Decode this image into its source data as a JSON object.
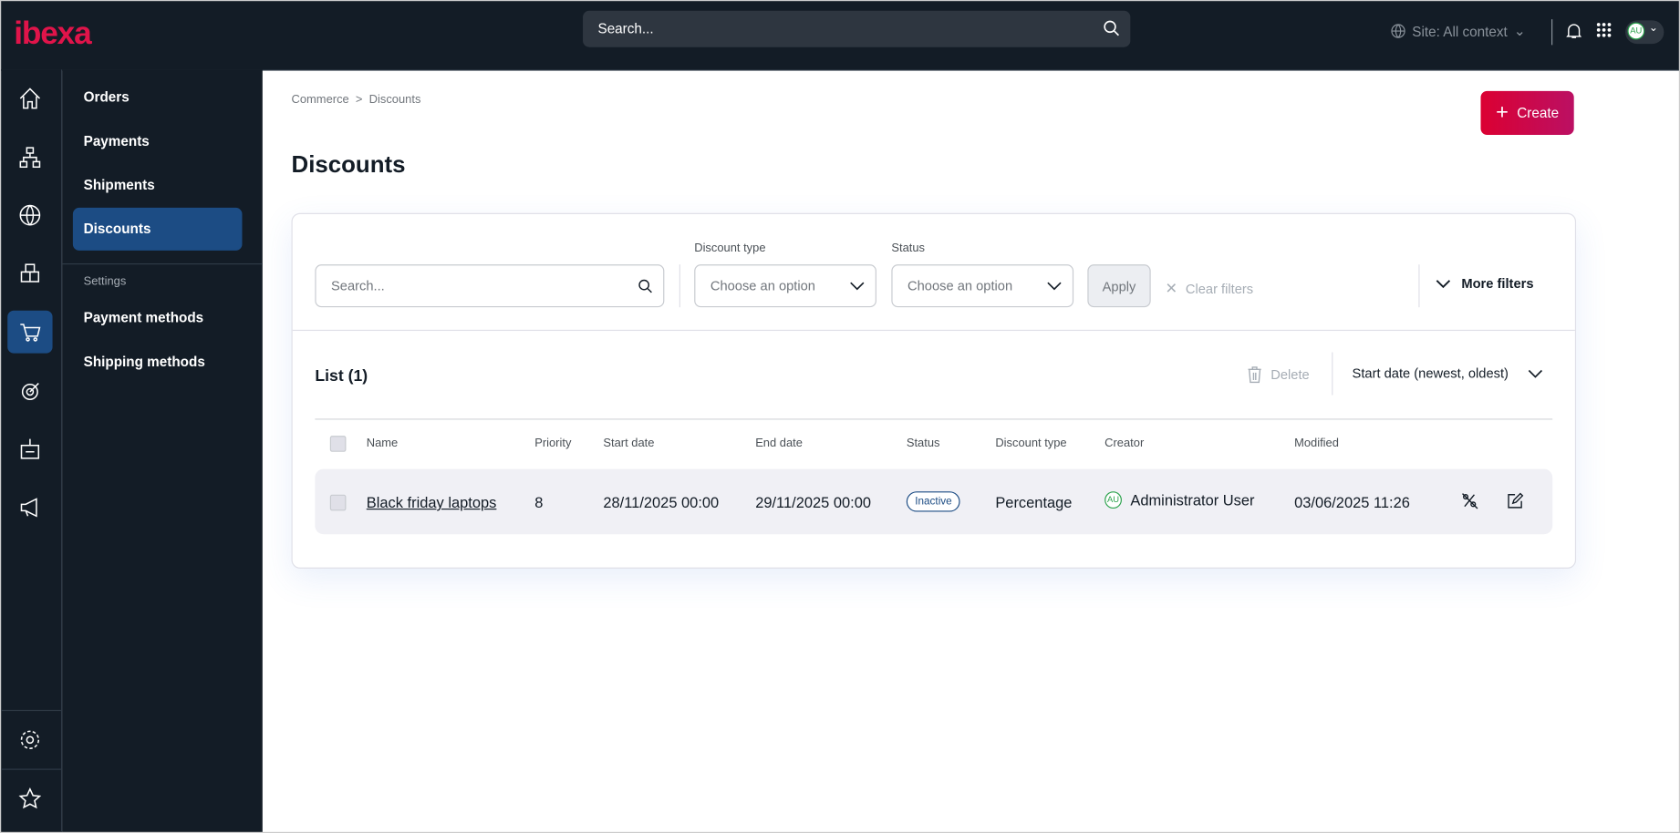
{
  "header": {
    "logo": "ibexa",
    "search_placeholder": "Search...",
    "site_label": "Site: All context",
    "avatar_initials": "AU"
  },
  "rail": [
    "home",
    "content-tree",
    "globe",
    "products",
    "commerce",
    "targeting",
    "customers",
    "marketing",
    "settings",
    "favorites"
  ],
  "sidebar": {
    "items": [
      {
        "label": "Orders"
      },
      {
        "label": "Payments"
      },
      {
        "label": "Shipments"
      },
      {
        "label": "Discounts",
        "active": true
      }
    ],
    "settings_heading": "Settings",
    "settings_items": [
      {
        "label": "Payment methods"
      },
      {
        "label": "Shipping methods"
      }
    ]
  },
  "breadcrumb": {
    "parent": "Commerce",
    "sep": ">",
    "current": "Discounts"
  },
  "page_title": "Discounts",
  "create_label": "Create",
  "filters": {
    "search_placeholder": "Search...",
    "discount_type_label": "Discount type",
    "discount_type_value": "Choose an option",
    "status_label": "Status",
    "status_value": "Choose an option",
    "apply": "Apply",
    "clear": "Clear filters",
    "more": "More filters"
  },
  "list": {
    "title": "List (1)",
    "delete": "Delete",
    "sort": "Start date (newest, oldest)",
    "columns": [
      "Name",
      "Priority",
      "Start date",
      "End date",
      "Status",
      "Discount type",
      "Creator",
      "Modified"
    ],
    "rows": [
      {
        "name": "Black friday laptops",
        "priority": "8",
        "start": "28/11/2025 00:00",
        "end": "29/11/2025 00:00",
        "status": "Inactive",
        "type": "Percentage",
        "creator_initials": "AU",
        "creator": "Administrator User",
        "modified": "03/06/2025 11:26"
      }
    ]
  },
  "colors": {
    "accent": "#db0032",
    "nav_active": "#1c4c84",
    "topbar": "#131c26"
  }
}
